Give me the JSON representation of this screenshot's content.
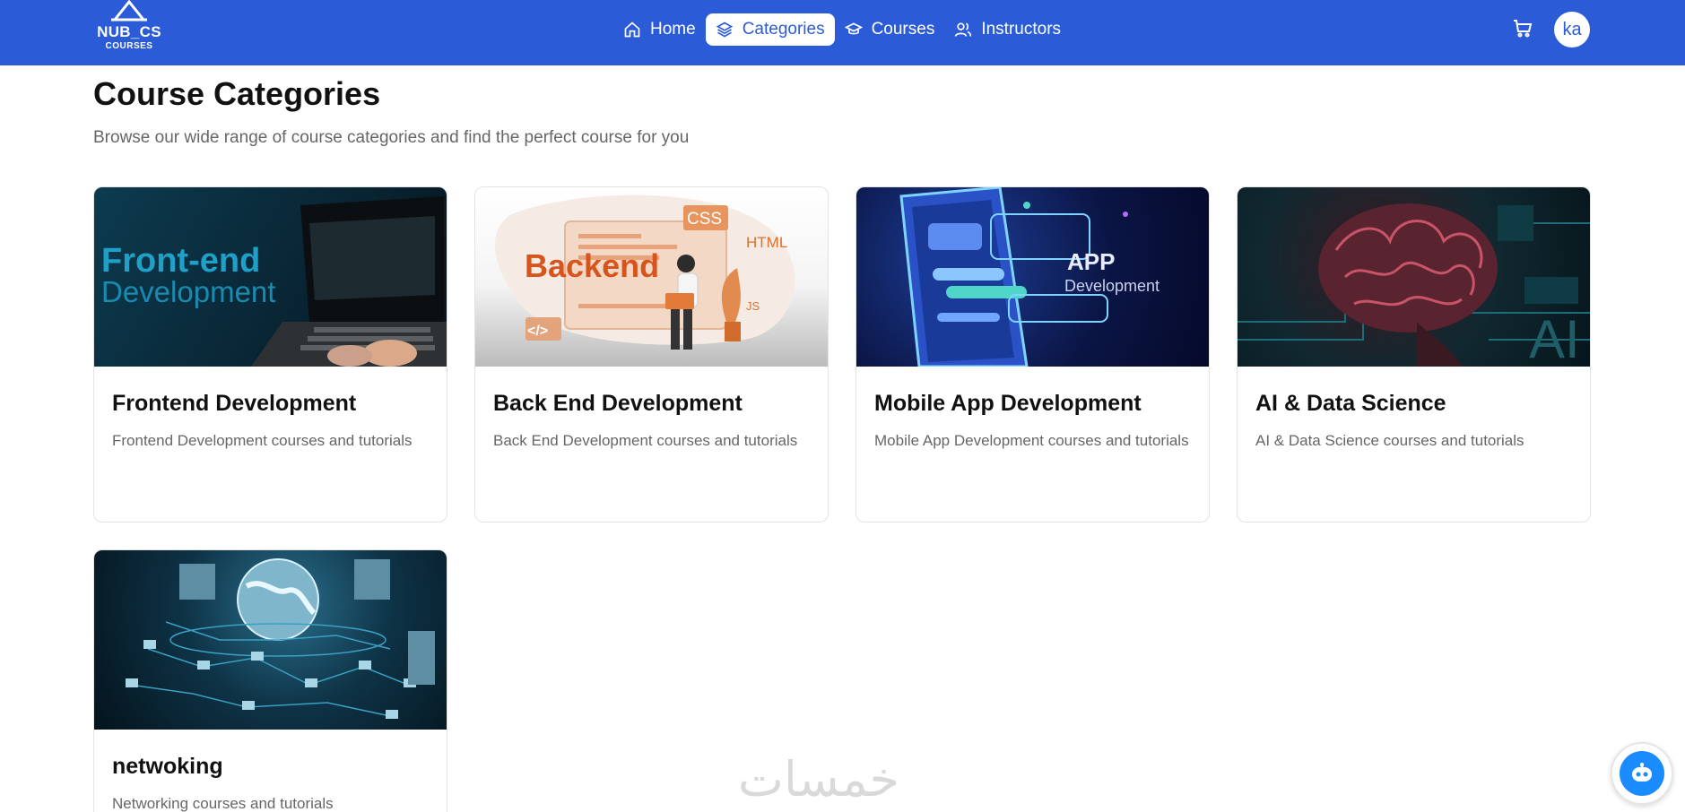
{
  "brand": {
    "name": "NUB_CS",
    "sub": "COURSES"
  },
  "nav": [
    {
      "label": "Home",
      "icon": "home-icon"
    },
    {
      "label": "Categories",
      "icon": "layers-icon",
      "active": true
    },
    {
      "label": "Courses",
      "icon": "graduation-cap-icon"
    },
    {
      "label": "Instructors",
      "icon": "users-icon"
    }
  ],
  "user": {
    "initials": "ka"
  },
  "page": {
    "title": "Course Categories",
    "subtitle": "Browse our wide range of course categories and find the perfect course for you"
  },
  "categories": [
    {
      "title": "Frontend Development",
      "description": "Frontend Development courses and tutorials",
      "image_text": [
        "Front-end",
        "Development"
      ]
    },
    {
      "title": "Back End Development",
      "description": "Back End Development courses and tutorials",
      "image_text": [
        "Backend",
        "CSS",
        "HTML",
        "JS",
        "</>"
      ]
    },
    {
      "title": "Mobile App Development",
      "description": "Mobile App Development courses and tutorials",
      "image_text": [
        "APP",
        "Development"
      ]
    },
    {
      "title": "AI & Data Science",
      "description": "AI & Data Science courses and tutorials",
      "image_text": [
        "AI"
      ]
    },
    {
      "title": "netwoking",
      "description": "Networking courses and tutorials",
      "image_text": []
    }
  ],
  "watermark": "خمسات",
  "colors": {
    "primary": "#2b5bd7",
    "chat": "#1a8cff"
  }
}
